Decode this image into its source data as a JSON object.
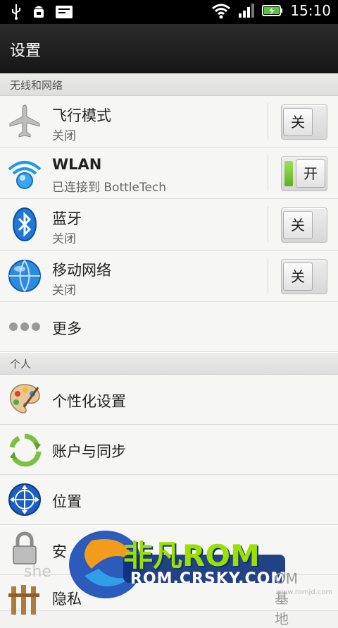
{
  "statusbar": {
    "time": "15:10"
  },
  "header": {
    "title": "设置"
  },
  "sections": {
    "wireless": "无线和网络",
    "personal": "个人"
  },
  "wireless_items": [
    {
      "label": "飞行模式",
      "sub": "关闭",
      "toggle": "关"
    },
    {
      "label": "WLAN",
      "sub": "已连接到 BottleTech",
      "toggle": "开"
    },
    {
      "label": "蓝牙",
      "sub": "关闭",
      "toggle": "关"
    },
    {
      "label": "移动网络",
      "sub": "关闭",
      "toggle": "关"
    },
    {
      "label": "更多"
    }
  ],
  "personal_items": [
    {
      "label": "个性化设置"
    },
    {
      "label": "账户与同步"
    },
    {
      "label": "位置"
    },
    {
      "label": "安"
    },
    {
      "label": "隐私"
    }
  ],
  "watermark": {
    "brand": "非凡ROM",
    "url": "ROM.CRSKY.COM",
    "side": "OM基地",
    "small": "www.romjd.com",
    "left": "she"
  },
  "colors": {
    "toggle_on": "#7bc53a",
    "brand_blue": "#1e4fb8",
    "brand_green": "#9be000"
  }
}
